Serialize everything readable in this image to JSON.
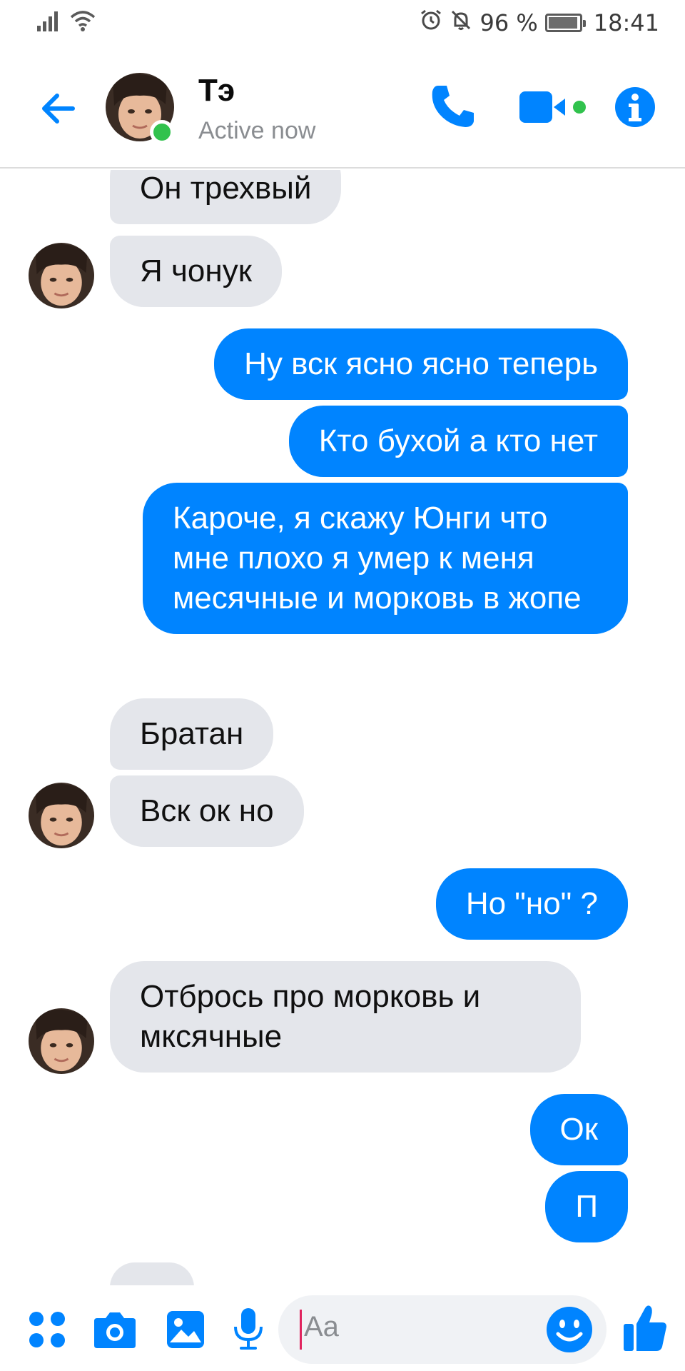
{
  "status_bar": {
    "battery_text": "96 %",
    "battery_level": 0.96,
    "time": "18:41",
    "icons": [
      "signal-icon",
      "wifi-icon",
      "alarm-icon",
      "mute-icon",
      "battery-icon"
    ]
  },
  "header": {
    "contact_name": "Тэ",
    "status": "Active now",
    "colors": {
      "accent": "#0084ff",
      "online": "#31c24d"
    }
  },
  "messages": [
    {
      "from": "contact",
      "text": "Он трехвый"
    },
    {
      "from": "contact",
      "text": "Я чонук"
    },
    {
      "from": "me",
      "text": "Ну вск ясно ясно теперь"
    },
    {
      "from": "me",
      "text": "Кто бухой а кто нет"
    },
    {
      "from": "me",
      "text": "Кароче, я скажу Юнги что мне плохо я умер к меня месячные и морковь в жопе"
    },
    {
      "from": "contact",
      "text": "Братан"
    },
    {
      "from": "contact",
      "text": "Вск ок но"
    },
    {
      "from": "me",
      "text": "Но \"но\" ?"
    },
    {
      "from": "contact",
      "text": "Отбрось про морковь и мксячные"
    },
    {
      "from": "me",
      "text": "Ок"
    },
    {
      "from": "me",
      "text": "П"
    }
  ],
  "composer": {
    "placeholder": "Aa",
    "icons": [
      "menu-dots-icon",
      "camera-icon",
      "gallery-icon",
      "microphone-icon",
      "emoji-icon",
      "thumbs-up-icon"
    ]
  }
}
